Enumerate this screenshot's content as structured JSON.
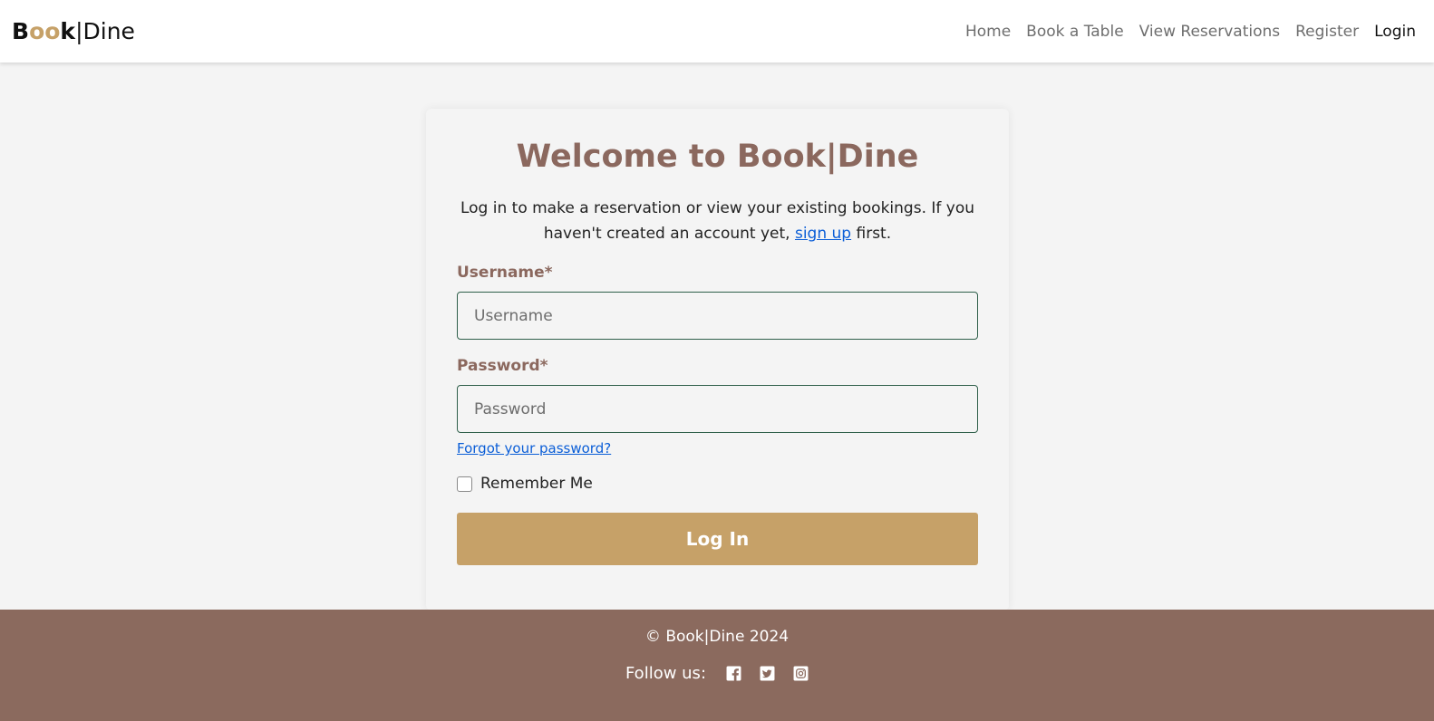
{
  "brand": {
    "part1": "B",
    "part2": "oo",
    "part3": "k",
    "divider": "|",
    "part4": "Dine"
  },
  "nav": {
    "items": [
      {
        "label": "Home"
      },
      {
        "label": "Book a Table"
      },
      {
        "label": "View Reservations"
      },
      {
        "label": "Register"
      },
      {
        "label": "Login",
        "active": true
      }
    ]
  },
  "card": {
    "title": "Welcome to Book|Dine",
    "intro_before": "Log in to make a reservation or view your existing bookings. If you haven't created an account yet, ",
    "intro_link": "sign up",
    "intro_after": " first.",
    "username_label": "Username*",
    "username_placeholder": "Username",
    "username_value": "",
    "password_label": "Password*",
    "password_placeholder": "Password",
    "password_value": "",
    "forgot_link": "Forgot your password?",
    "remember_label": "Remember Me",
    "remember_checked": false,
    "login_button": "Log In"
  },
  "footer": {
    "copyright": "© Book|Dine 2024",
    "follow_label": "Follow us:",
    "social": [
      "facebook-icon",
      "twitter-icon",
      "instagram-icon"
    ]
  },
  "colors": {
    "accent_gold": "#c6a168",
    "brown": "#8b685e",
    "footer_bg": "#8b6a5e",
    "link_blue": "#0b5ed7",
    "input_border": "#2f5f4a"
  }
}
